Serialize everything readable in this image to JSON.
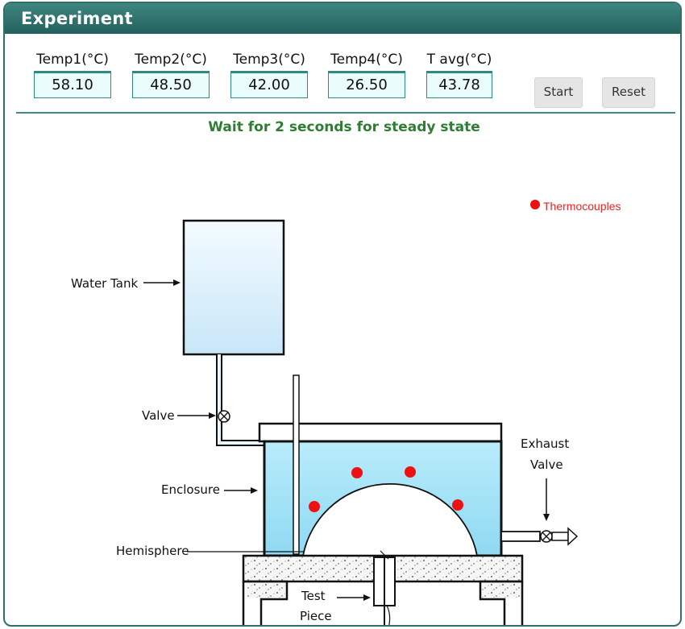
{
  "panel": {
    "title": "Experiment"
  },
  "temps": [
    {
      "label": "Temp1(°C)",
      "value": "58.10"
    },
    {
      "label": "Temp2(°C)",
      "value": "48.50"
    },
    {
      "label": "Temp3(°C)",
      "value": "42.00"
    },
    {
      "label": "Temp4(°C)",
      "value": "26.50"
    },
    {
      "label": "T avg(°C)",
      "value": "43.78"
    }
  ],
  "buttons": {
    "start": "Start",
    "reset": "Reset"
  },
  "status": "Wait for 2 seconds for steady state",
  "diagram": {
    "legend": "Thermocouples",
    "labels": {
      "water_tank": "Water Tank",
      "valve": "Valve",
      "enclosure": "Enclosure",
      "hemisphere": "Hemisphere",
      "exhaust_1": "Exhaust",
      "exhaust_2": "Valve",
      "test_1": "Test",
      "test_2": "Piece"
    },
    "colors": {
      "thermocouple": "#ee1111",
      "water": "#8fd9f2",
      "accent": "#2f6f68"
    }
  }
}
